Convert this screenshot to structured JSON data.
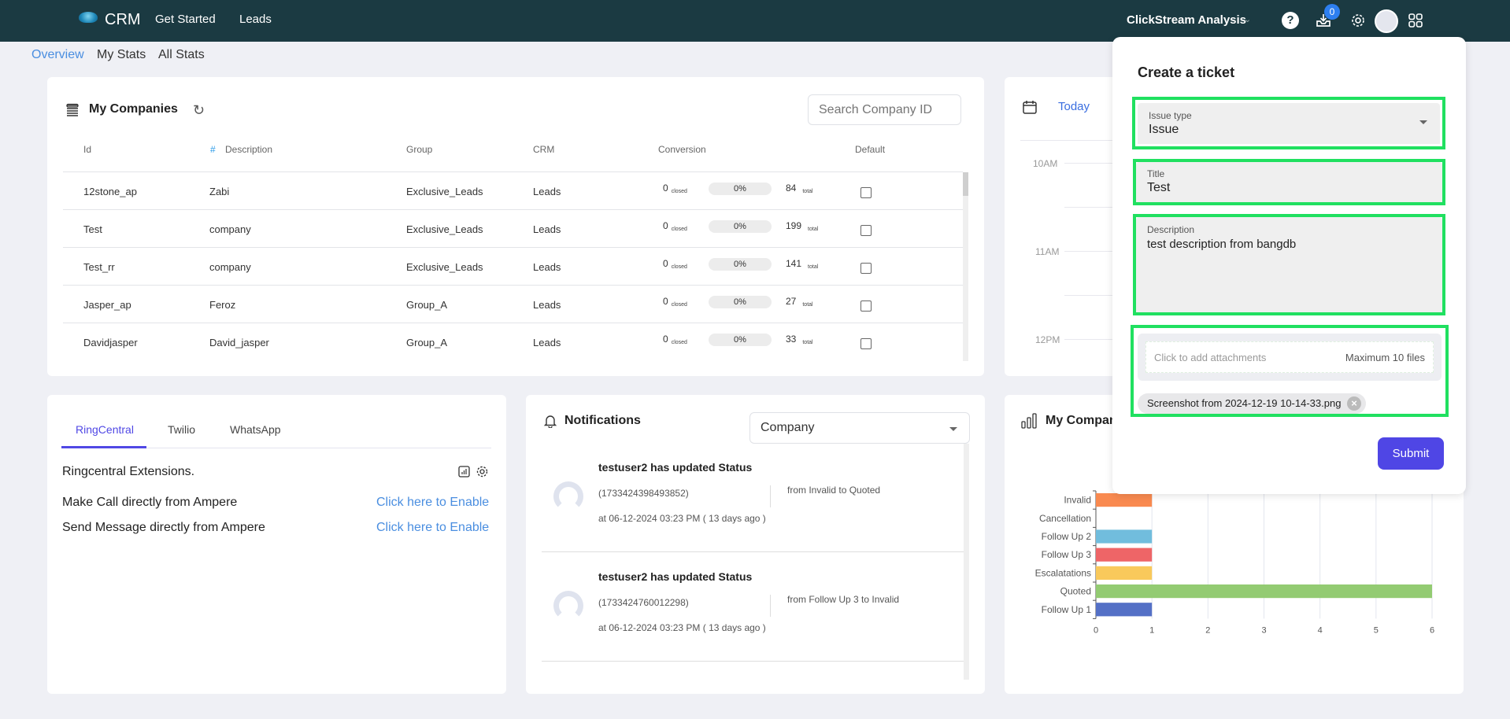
{
  "topbar": {
    "brand": "CRM",
    "nav": [
      "Get Started",
      "Leads"
    ],
    "workspace": "ClickStream Analysis",
    "help_glyph": "?",
    "inbox_badge": "0",
    "icons": [
      "help-icon",
      "inbox-icon",
      "gear-icon",
      "avatar",
      "apps-grid-icon"
    ]
  },
  "subnav": {
    "tabs": [
      "Overview",
      "My Stats",
      "All Stats"
    ],
    "active": "Overview"
  },
  "companies": {
    "title": "My Companies",
    "search_placeholder": "Search Company ID",
    "columns": [
      "Id",
      "#",
      "Description",
      "Group",
      "CRM",
      "Conversion",
      "Default"
    ],
    "closed_label": "closed",
    "total_label": "total",
    "rows": [
      {
        "id": "12stone_ap",
        "description": "Zabi",
        "group": "Exclusive_Leads",
        "crm": "Leads",
        "closed": "0",
        "percent": "0%",
        "total": "84",
        "default": false
      },
      {
        "id": "Test",
        "description": "company",
        "group": "Exclusive_Leads",
        "crm": "Leads",
        "closed": "0",
        "percent": "0%",
        "total": "199",
        "default": false
      },
      {
        "id": "Test_rr",
        "description": "company",
        "group": "Exclusive_Leads",
        "crm": "Leads",
        "closed": "0",
        "percent": "0%",
        "total": "141",
        "default": false
      },
      {
        "id": "Jasper_ap",
        "description": "Feroz",
        "group": "Group_A",
        "crm": "Leads",
        "closed": "0",
        "percent": "0%",
        "total": "27",
        "default": false
      },
      {
        "id": "Davidjasper",
        "description": "David_jasper",
        "group": "Group_A",
        "crm": "Leads",
        "closed": "0",
        "percent": "0%",
        "total": "33",
        "default": false
      }
    ]
  },
  "calendar": {
    "today_label": "Today",
    "times": [
      "10AM",
      "11AM",
      "12PM"
    ]
  },
  "integrations": {
    "tabs": [
      "RingCentral",
      "Twilio",
      "WhatsApp"
    ],
    "active_tab": "RingCentral",
    "heading": "Ringcentral Extensions.",
    "items": [
      {
        "label": "Make Call directly from Ampere",
        "link": "Click here to Enable"
      },
      {
        "label": "Send Message directly from Ampere",
        "link": "Click here to Enable"
      }
    ]
  },
  "notifications": {
    "title": "Notifications",
    "filter_value": "Company",
    "items": [
      {
        "title": "testuser2 has updated Status",
        "id": "(1733424398493852)",
        "change": "from Invalid to Quoted",
        "time": "at 06-12-2024 03:23 PM ( 13 days ago )"
      },
      {
        "title": "testuser2 has updated Status",
        "id": "(1733424760012298)",
        "change": "from Follow Up 3 to Invalid",
        "time": "at 06-12-2024 03:23 PM ( 13 days ago )"
      }
    ]
  },
  "chart_card": {
    "title": "My Companies"
  },
  "chart_data": {
    "type": "bar",
    "orientation": "horizontal",
    "title": "My Companies",
    "categories": [
      "Invalid",
      "Cancellation",
      "Follow Up 2",
      "Follow Up 3",
      "Escalatations",
      "Quoted",
      "Follow Up 1"
    ],
    "values": [
      1,
      0,
      1,
      1,
      1,
      6,
      1
    ],
    "colors": [
      "#f98a50",
      "#cccccc",
      "#71bddd",
      "#ee6567",
      "#f9c95b",
      "#93cb72",
      "#5470c6"
    ],
    "xlim": [
      0,
      6
    ],
    "xticks": [
      "0",
      "1",
      "2",
      "3",
      "4",
      "5",
      "6"
    ],
    "grid": true,
    "xlabel": "",
    "ylabel": ""
  },
  "ticket": {
    "title": "Create a ticket",
    "issue_type_label": "Issue type",
    "issue_type_value": "Issue",
    "title_label": "Title",
    "title_value": "Test",
    "description_label": "Description",
    "description_value": "test description from bangdb",
    "attach_placeholder": "Click to add attachments",
    "attach_limit": "Maximum 10 files",
    "attachment": "Screenshot from 2024-12-19 10-14-33.png",
    "submit_label": "Submit",
    "highlight_color": "#20e060",
    "accent_color": "#4f46e5"
  }
}
